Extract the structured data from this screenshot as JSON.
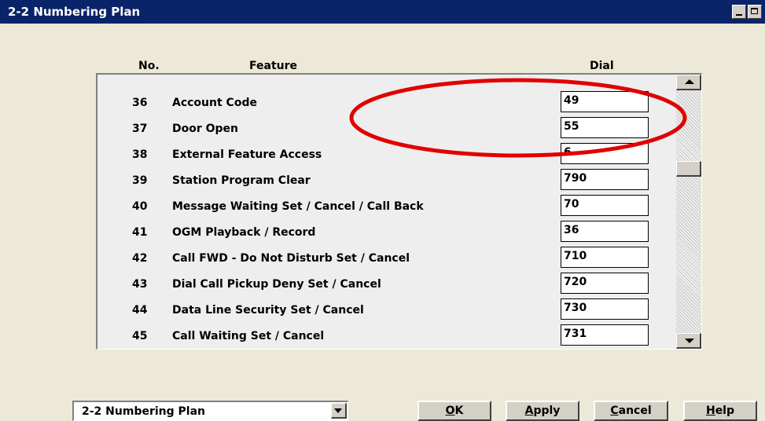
{
  "window": {
    "title": "2-2 Numbering Plan"
  },
  "columns": {
    "no": "No.",
    "feature": "Feature",
    "dial": "Dial"
  },
  "rows": [
    {
      "no": "36",
      "feature": "Account Code",
      "dial": "49"
    },
    {
      "no": "37",
      "feature": "Door Open",
      "dial": "55"
    },
    {
      "no": "38",
      "feature": "External Feature Access",
      "dial": "6"
    },
    {
      "no": "39",
      "feature": "Station Program Clear",
      "dial": "790"
    },
    {
      "no": "40",
      "feature": "Message Waiting Set / Cancel / Call Back",
      "dial": "70"
    },
    {
      "no": "41",
      "feature": "OGM Playback / Record",
      "dial": "36"
    },
    {
      "no": "42",
      "feature": "Call FWD - Do Not Disturb Set / Cancel",
      "dial": "710"
    },
    {
      "no": "43",
      "feature": "Dial Call Pickup Deny Set / Cancel",
      "dial": "720"
    },
    {
      "no": "44",
      "feature": "Data Line Security Set / Cancel",
      "dial": "730"
    },
    {
      "no": "45",
      "feature": "Call Waiting Set / Cancel",
      "dial": "731"
    }
  ],
  "footer": {
    "combo_value": "2-2 Numbering Plan",
    "ok": {
      "mnemonic": "O",
      "rest": "K"
    },
    "apply": {
      "mnemonic": "A",
      "rest": "pply"
    },
    "cancel": {
      "mnemonic": "C",
      "rest": "ancel"
    },
    "help": {
      "mnemonic": "H",
      "rest": "elp"
    }
  },
  "colors": {
    "titlebar": "#0a246a",
    "highlight_ellipse": "#e00000",
    "dialog_bg": "#ece9d8"
  },
  "icons": [
    "minimize-icon",
    "maximize-icon",
    "scroll-up-icon",
    "scroll-down-icon",
    "dropdown-arrow-icon"
  ]
}
